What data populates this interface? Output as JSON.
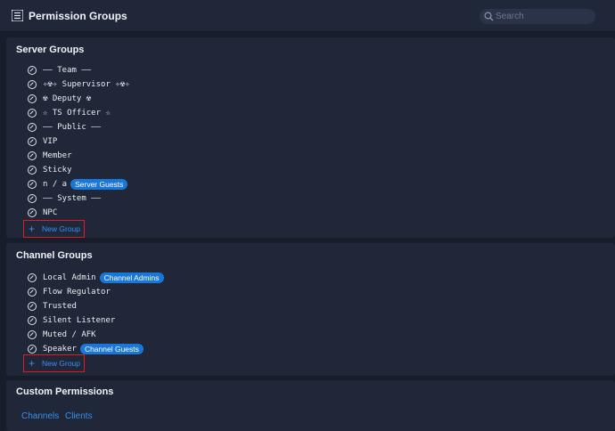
{
  "header": {
    "title": "Permission Groups",
    "search_placeholder": "Search"
  },
  "server_groups": {
    "title": "Server Groups",
    "items": [
      {
        "label": "—— Team ——",
        "badge": ""
      },
      {
        "label": "✧☢✧ Supervisor ✧☢✧",
        "badge": ""
      },
      {
        "label": "☢ Deputy ☢",
        "badge": ""
      },
      {
        "label": "☆ TS Officer ☆",
        "badge": ""
      },
      {
        "label": "—— Public ——",
        "badge": ""
      },
      {
        "label": "VIP",
        "badge": ""
      },
      {
        "label": "Member",
        "badge": ""
      },
      {
        "label": "Sticky",
        "badge": ""
      },
      {
        "label": "n / a",
        "badge": "Server Guests"
      },
      {
        "label": "—— System ——",
        "badge": ""
      },
      {
        "label": "NPC",
        "badge": ""
      }
    ],
    "new_group_label": "New Group"
  },
  "channel_groups": {
    "title": "Channel Groups",
    "items": [
      {
        "label": "Local Admin",
        "badge": "Channel Admins"
      },
      {
        "label": "Flow Regulator",
        "badge": ""
      },
      {
        "label": "Trusted",
        "badge": ""
      },
      {
        "label": "Silent Listener",
        "badge": ""
      },
      {
        "label": "Muted / AFK",
        "badge": ""
      },
      {
        "label": "Speaker",
        "badge": "Channel Guests"
      }
    ],
    "new_group_label": "New Group"
  },
  "custom_permissions": {
    "title": "Custom Permissions",
    "links": [
      "Channels",
      "Clients"
    ]
  },
  "colors": {
    "background": "#161d2b",
    "panel": "#1f2739",
    "accent": "#1a77d6",
    "link": "#3a8ff0",
    "highlight_box": "#e01b24"
  }
}
